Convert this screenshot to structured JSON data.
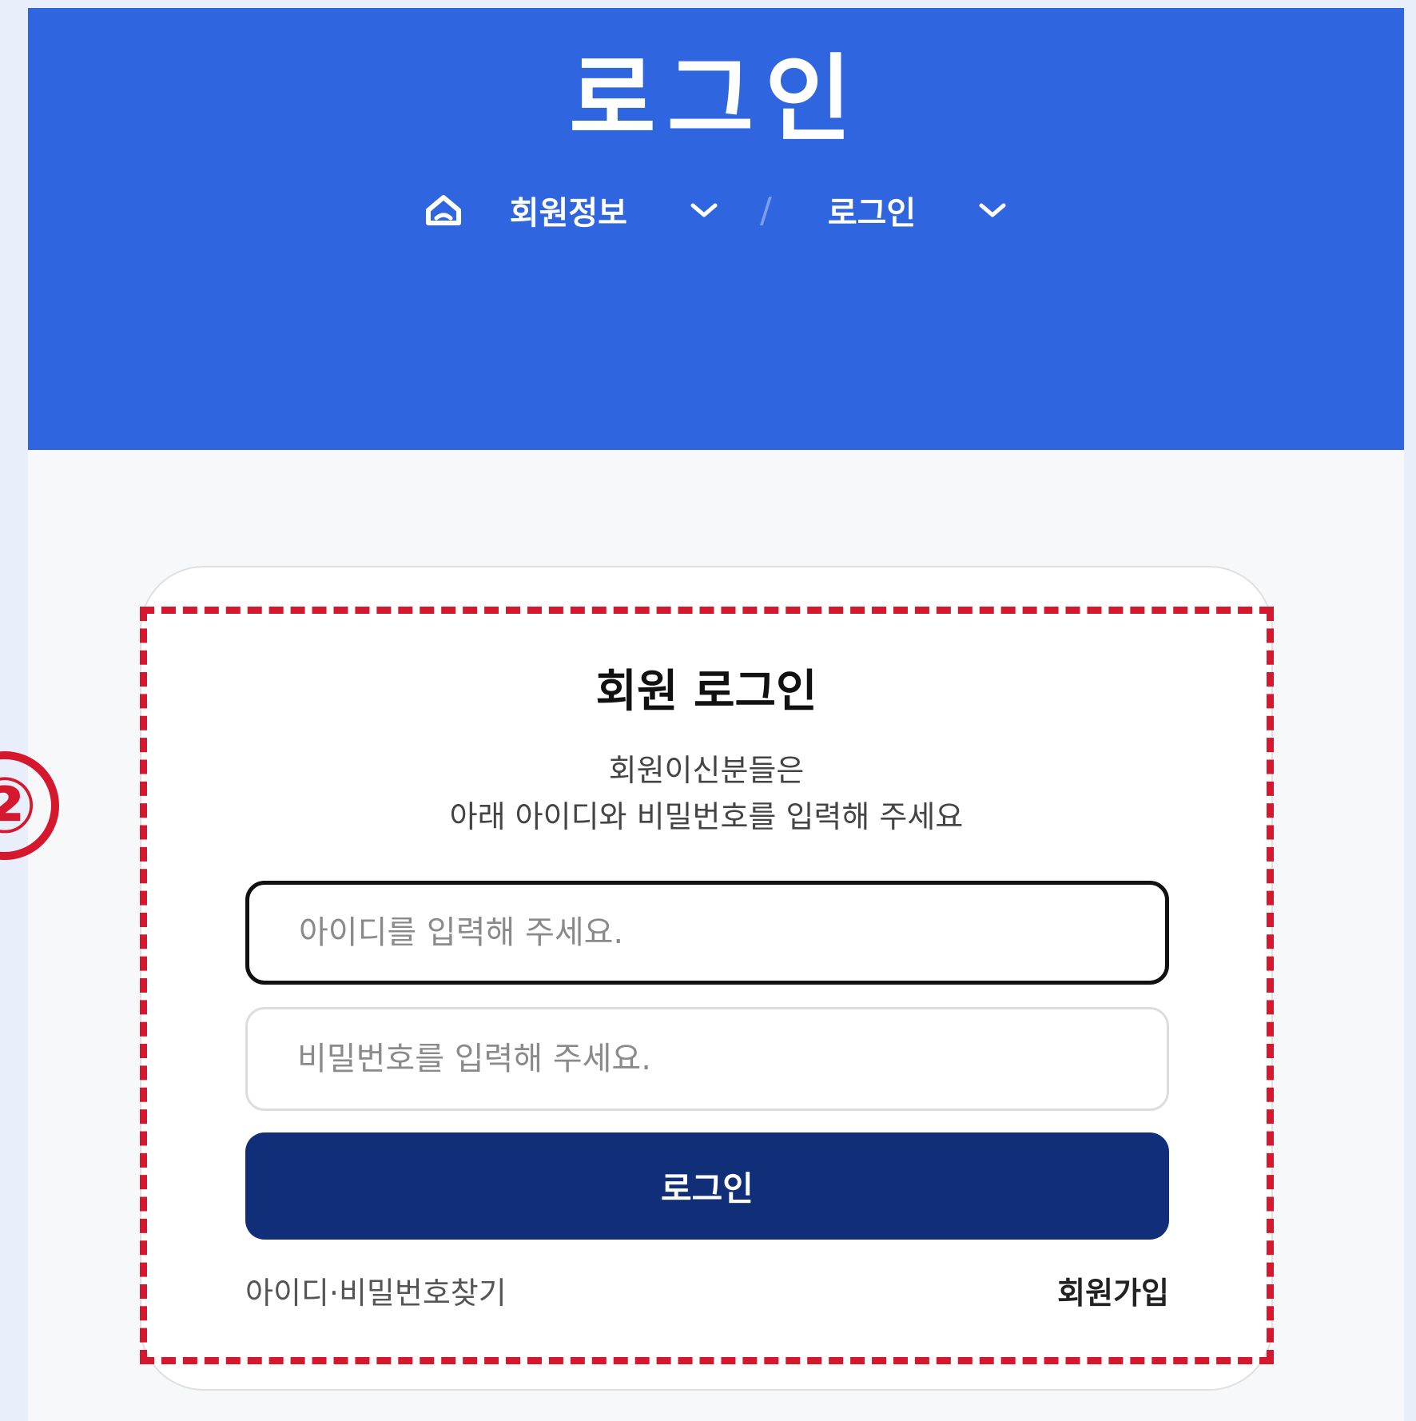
{
  "header": {
    "title": "로그인",
    "breadcrumb": {
      "home_icon": "home-icon",
      "items": [
        {
          "label": "회원정보",
          "icon": "chevron-down-icon"
        },
        {
          "label": "로그인",
          "icon": "chevron-down-icon"
        }
      ],
      "separator": "/"
    }
  },
  "login": {
    "title": "회원 로그인",
    "description_line1": "회원이신분들은",
    "description_line2": "아래 아이디와 비밀번호를 입력해 주세요",
    "id_field": {
      "placeholder": "아이디를 입력해 주세요.",
      "value": ""
    },
    "password_field": {
      "placeholder": "비밀번호를 입력해 주세요.",
      "value": ""
    },
    "submit_label": "로그인",
    "find_account_label": "아이디·비밀번호찾기",
    "signup_label": "회원가입"
  },
  "annotation": {
    "marker": "②",
    "color": "#d6182f"
  },
  "colors": {
    "hero_background": "#2f66e0",
    "button_background": "#112f78"
  }
}
